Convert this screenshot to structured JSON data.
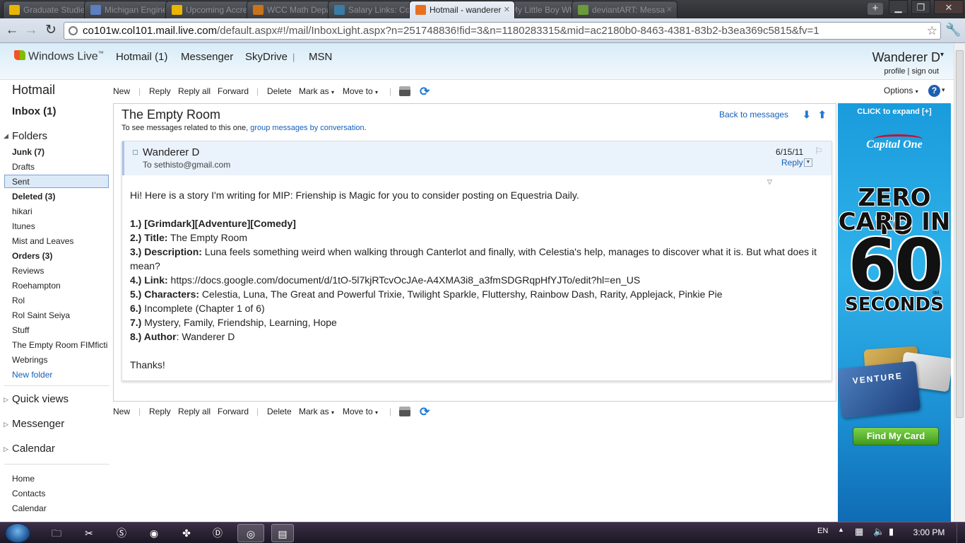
{
  "browser": {
    "tabs": [
      {
        "label": "Graduate Studies |",
        "icon": "michigan-block-m-icon",
        "color": "#e8b600"
      },
      {
        "label": "Michigan Engineeri",
        "icon": "michigan-engineering-icon",
        "color": "#5b7fc0"
      },
      {
        "label": "Upcoming Accredit",
        "icon": "michigan-block-m-icon",
        "color": "#e8b600"
      },
      {
        "label": "WCC Math Departi",
        "icon": "wcc-icon",
        "color": "#c8741a"
      },
      {
        "label": "Salary Links: Comp",
        "icon": "salary-links-icon",
        "color": "#3a7ca5"
      },
      {
        "label": "Hotmail - wanderer",
        "icon": "hotmail-icon",
        "color": "#e86f1f"
      },
      {
        "label": "My Little Boy Who",
        "icon": "page-icon",
        "color": "#6b6fb4"
      },
      {
        "label": "deviantART: Messa",
        "icon": "deviantart-icon",
        "color": "#6a9a3a"
      }
    ],
    "active_tab_index": 5,
    "url_host": "co101w.col101.mail.live.com",
    "url_rest": "/default.aspx#!/mail/InboxLight.aspx?n=251748836!fid=3&n=1180283315&mid=ac2180b0-8463-4381-83b2-b3ea369c5815&fv=1"
  },
  "header": {
    "brand": "Windows Live",
    "trademark": "™",
    "nav": [
      "Hotmail (1)",
      "Messenger",
      "SkyDrive",
      "MSN"
    ],
    "nav_separator": "|",
    "account_name": "Wanderer D",
    "account_caret": "▾",
    "profile": "profile",
    "signout": "sign out",
    "link_separator": "|"
  },
  "sidebar": {
    "title": "Hotmail",
    "inbox": "Inbox (1)",
    "folders_label": "Folders",
    "folders": [
      {
        "label": "Junk (7)",
        "bold": true
      },
      {
        "label": "Drafts",
        "bold": false
      },
      {
        "label": "Sent",
        "bold": false,
        "selected": true
      },
      {
        "label": "Deleted (3)",
        "bold": true
      },
      {
        "label": "hikari",
        "bold": false
      },
      {
        "label": "Itunes",
        "bold": false
      },
      {
        "label": "Mist and Leaves",
        "bold": false
      },
      {
        "label": "Orders (3)",
        "bold": true
      },
      {
        "label": "Reviews",
        "bold": false
      },
      {
        "label": "Roehampton",
        "bold": false
      },
      {
        "label": "Rol",
        "bold": false
      },
      {
        "label": "Rol Saint Seiya",
        "bold": false
      },
      {
        "label": "Stuff",
        "bold": false
      },
      {
        "label": "The Empty Room FIMficti",
        "bold": false
      },
      {
        "label": "Webrings",
        "bold": false
      }
    ],
    "new_folder": "New folder",
    "quick_views": "Quick views",
    "messenger": "Messenger",
    "calendar": "Calendar",
    "bottom_links": [
      "Home",
      "Contacts",
      "Calendar"
    ]
  },
  "commands": {
    "new": "New",
    "reply": "Reply",
    "reply_all": "Reply all",
    "forward": "Forward",
    "delete": "Delete",
    "mark_as": "Mark as",
    "move_to": "Move to",
    "caret": "▾",
    "separator": "|",
    "options": "Options",
    "help": "?"
  },
  "message": {
    "subject": "The Empty Room",
    "conv_hint": "To see messages related to this one,",
    "conv_link": "group messages by conversation",
    "conv_period": ".",
    "back": "Back to messages",
    "sender": "Wanderer D",
    "recipient": "To sethisto@gmail.com",
    "date": "6/15/11",
    "reply": "Reply",
    "intro": "Hi! Here is a story I'm writing for MIP: Frienship is Magic for you to consider posting on Equestria Daily.",
    "fields": [
      {
        "label": "1.) [Grimdark][Adventure][Comedy]",
        "value": ""
      },
      {
        "label": "2.) Title:",
        "value": " The Empty Room"
      },
      {
        "label": "3.) Description:",
        "value": " Luna feels something weird when walking through Canterlot and finally, with Celestia's help, manages to discover what it is. But what does it mean?"
      },
      {
        "label": "4.) Link:",
        "value": " https://docs.google.com/document/d/1tO-5l7kjRTcvOcJAe-A4XMA3i8_a3fmSDGRqpHfYJTo/edit?hl=en_US"
      },
      {
        "label": "5.) Characters:",
        "value": " Celestia, Luna, The Great and Powerful Trixie, Twilight Sparkle, Fluttershy, Rainbow Dash, Rarity, Applejack, Pinkie Pie"
      },
      {
        "label": "6.)",
        "value": " Incomplete (Chapter 1 of 6)"
      },
      {
        "label": "7.)",
        "value": " Mystery, Family, Friendship, Learning, Hope"
      },
      {
        "label": "8.) Author",
        "value": ": Wanderer D"
      }
    ],
    "closing": "Thanks!"
  },
  "ad": {
    "expand": "CLICK to expand [+]",
    "brand": "Capital One",
    "line1": "ZERO TO",
    "line2": "CARD IN",
    "big": "60",
    "sm": "SM",
    "line3": "SECONDS",
    "card_text": "VENTURE",
    "cta": "Find My Card"
  },
  "taskbar": {
    "lang": "EN",
    "time": "3:00 PM"
  }
}
